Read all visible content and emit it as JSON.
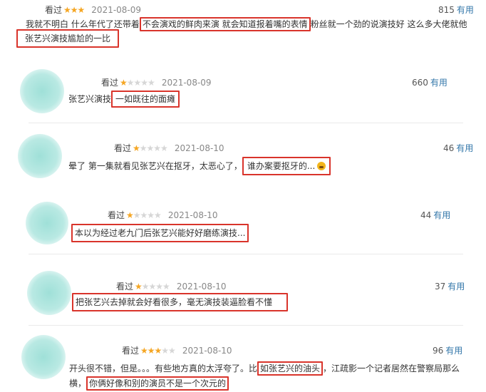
{
  "reviews": [
    {
      "seen": "看过",
      "stars_on": "★★★",
      "stars_off": "",
      "date": "2021-08-09",
      "votes": "815",
      "useful": "有用",
      "line1_a": "我就不明白 什么年代了还带着",
      "line1_hl": "不会演戏的鲜肉来演 就会知道报着嘴的表情",
      "line1_b": "粉丝就一个劲的说演技好 这么多大佬就他",
      "line2_hl": "张艺兴演技尴尬的一比"
    },
    {
      "seen": "看过",
      "stars_on": "★",
      "stars_off": "★★★★",
      "date": "2021-08-09",
      "votes": "660",
      "useful": "有用",
      "text_a": "张艺兴演技",
      "text_hl": "一如既往的面瘫"
    },
    {
      "seen": "看过",
      "stars_on": "★",
      "stars_off": "★★★★",
      "date": "2021-08-10",
      "votes": "46",
      "useful": "有用",
      "text_a": "晕了 第一集就看见张艺兴在抠牙，太恶心了，",
      "text_hl": "谁办案要抠牙的..."
    },
    {
      "seen": "看过",
      "stars_on": "★",
      "stars_off": "★★★★",
      "date": "2021-08-10",
      "votes": "44",
      "useful": "有用",
      "text_hl": "本以为经过老九门后张艺兴能好好磨练演技..."
    },
    {
      "seen": "看过",
      "stars_on": "★",
      "stars_off": "★★★★",
      "date": "2021-08-10",
      "votes": "37",
      "useful": "有用",
      "text_hl": "把张艺兴去掉就会好看很多，毫无演技装逼脸看不懂"
    },
    {
      "seen": "看过",
      "stars_on": "★★★",
      "stars_off": "★★",
      "date": "2021-08-10",
      "votes": "96",
      "useful": "有用",
      "line1_a": "开头很不错，但是。。。有些地方真的太浮夸了。比",
      "line1_hl": "如张艺兴的油头",
      "line1_b": "，江疏影一个记者居然在警察局那么",
      "line2_a": "横，",
      "line2_hl": "你俩好像和别的演员不是一个次元的"
    }
  ],
  "colors": {
    "highlight_box": "#d9342b",
    "useful_link": "#3377aa",
    "star": "#f5a623",
    "avatar": "#9fe0d8"
  }
}
